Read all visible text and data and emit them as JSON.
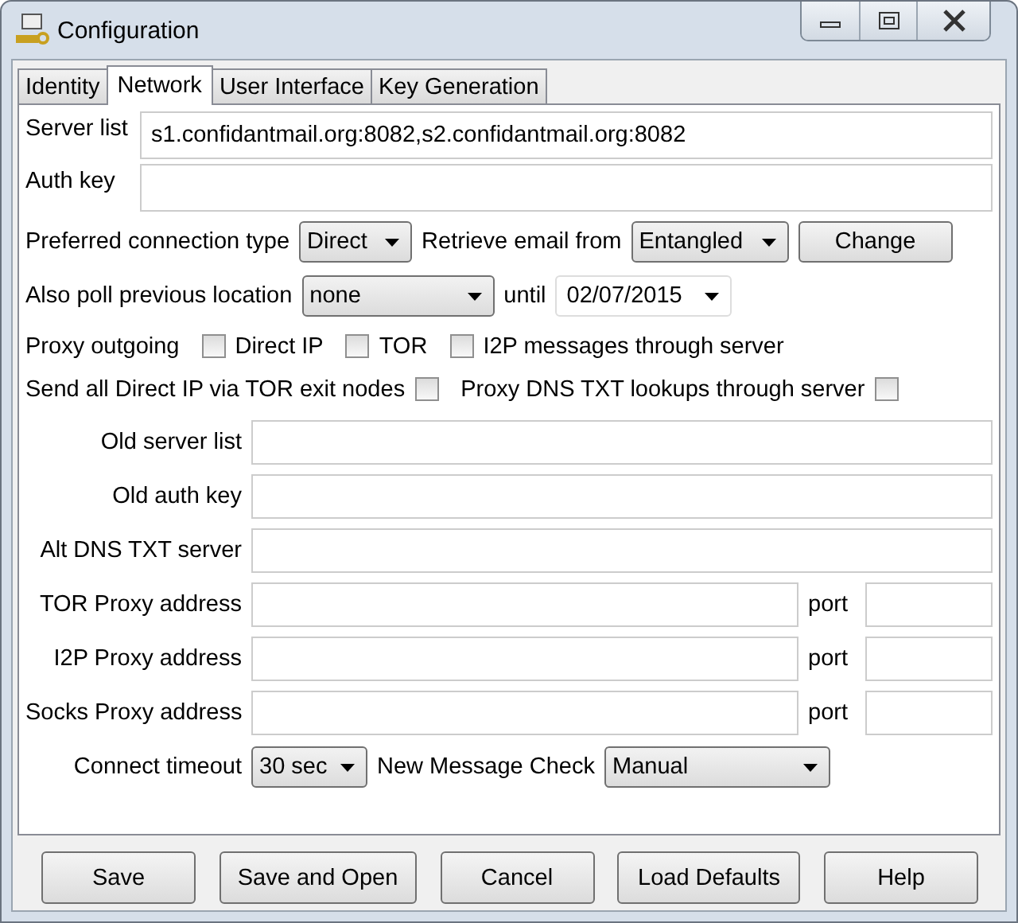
{
  "window": {
    "title": "Configuration"
  },
  "tabs": [
    {
      "label": "Identity",
      "selected": false
    },
    {
      "label": "Network",
      "selected": true
    },
    {
      "label": "User Interface",
      "selected": false
    },
    {
      "label": "Key Generation",
      "selected": false
    }
  ],
  "server_list": {
    "label": "Server list",
    "value": "s1.confidantmail.org:8082,s2.confidantmail.org:8082"
  },
  "auth_key": {
    "label": "Auth key"
  },
  "connection_type": {
    "label": "Preferred connection type",
    "value": "Direct"
  },
  "retrieve_from": {
    "label": "Retrieve email from",
    "value": "Entangled"
  },
  "change_button": "Change",
  "poll_location": {
    "label": "Also poll previous location",
    "value": "none"
  },
  "until": {
    "label": "until",
    "value": "02/07/2015"
  },
  "proxy_outgoing": {
    "label": "Proxy outgoing",
    "options": [
      {
        "label": "Direct IP",
        "checked": false
      },
      {
        "label": "TOR",
        "checked": false
      },
      {
        "label": "I2P messages through server",
        "checked": false
      }
    ]
  },
  "trailing_checks": [
    {
      "label": "Send all Direct IP via TOR exit nodes",
      "checked": false
    },
    {
      "label": "Proxy DNS TXT lookups through server",
      "checked": false
    }
  ],
  "address_fields": [
    {
      "label": "Old server list"
    },
    {
      "label": "Old auth key"
    },
    {
      "label": "Alt DNS TXT server"
    }
  ],
  "proxy_fields": [
    {
      "label": "TOR Proxy address",
      "port_label": "port"
    },
    {
      "label": "I2P Proxy address",
      "port_label": "port"
    },
    {
      "label": "Socks Proxy address",
      "port_label": "port"
    }
  ],
  "connect_timeout": {
    "label": "Connect timeout",
    "value": "30 sec"
  },
  "message_check": {
    "label": "New Message Check",
    "value": "Manual"
  },
  "buttons": [
    "Save",
    "Save and Open",
    "Cancel",
    "Load Defaults",
    "Help"
  ]
}
